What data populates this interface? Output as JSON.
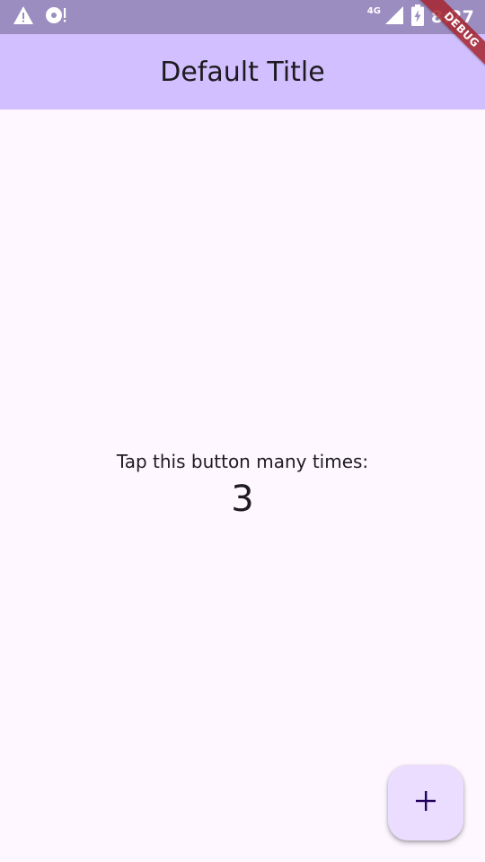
{
  "status_bar": {
    "left_icons": [
      "warning-icon",
      "disc-alert-icon"
    ],
    "network_type": "4G",
    "right_icons": [
      "signal-icon",
      "battery-charging-icon"
    ],
    "time": "8:27"
  },
  "debug_banner": {
    "label": "DEBUG"
  },
  "app_bar": {
    "title": "Default Title"
  },
  "main": {
    "prompt": "Tap this button many times:",
    "counter": "3"
  },
  "fab": {
    "icon": "add-icon"
  },
  "colors": {
    "status_bar": "#9c8dc0",
    "app_bar": "#d1bfff",
    "background": "#fef7ff",
    "fab": "#eaddff",
    "on_surface": "#1d1b20",
    "debug_ribbon": "#a6232d"
  }
}
